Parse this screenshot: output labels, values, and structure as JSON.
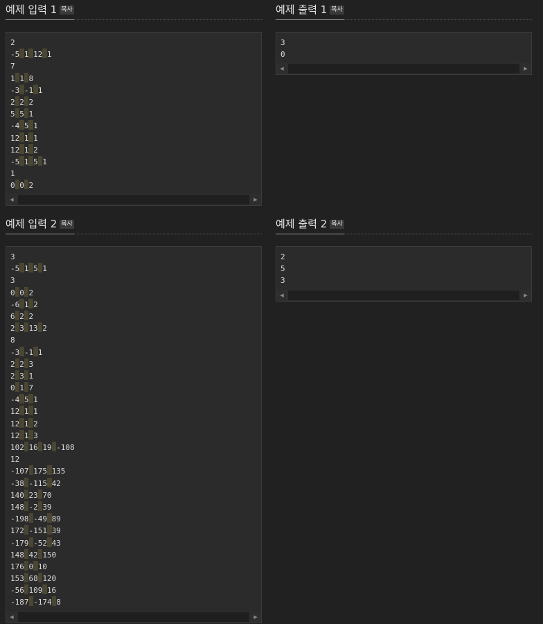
{
  "copy_label": "복사",
  "sections": [
    {
      "title": "예제 입력 1",
      "lines": [
        "2",
        "-5 1 12 1",
        "7",
        "1 1 8",
        "-3 -1 1",
        "2 2 2",
        "5 5 1",
        "-4 5 1",
        "12 1 1",
        "12 1 2",
        "-5 1 5 1",
        "1",
        "0 0 2"
      ]
    },
    {
      "title": "예제 출력 1",
      "lines": [
        "3",
        "0"
      ]
    },
    {
      "title": "예제 입력 2",
      "lines": [
        "3",
        "-5 1 5 1",
        "3",
        "0 0 2",
        "-6 1 2",
        "6 2 2",
        "2 3 13 2",
        "8",
        "-3 -1 1",
        "2 2 3",
        "2 3 1",
        "0 1 7",
        "-4 5 1",
        "12 1 1",
        "12 1 2",
        "12 1 3",
        "102 16 19 -108",
        "12",
        "-107 175 135",
        "-38 -115 42",
        "140 23 70",
        "148 -2 39",
        "-198 -49 89",
        "172 -151 39",
        "-179 -52 43",
        "148 42 150",
        "176 0 10",
        "153 68 120",
        "-56 109 16",
        "-187 -174 8"
      ]
    },
    {
      "title": "예제 출력 2",
      "lines": [
        "2",
        "5",
        "3"
      ]
    }
  ],
  "scroll_left_icon": "arrow-left-icon",
  "scroll_right_icon": "arrow-right-icon",
  "colors": {
    "background": "#212121",
    "code_background": "#2b2b2b",
    "space_highlight": "#4a4631",
    "copy_button": "#3a3a3a"
  }
}
